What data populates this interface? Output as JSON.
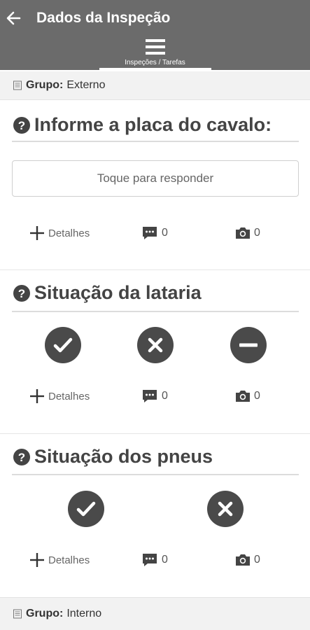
{
  "header": {
    "title": "Dados da Inspeção",
    "menu_label": "Inspeções / Tarefas"
  },
  "groups": [
    {
      "label": "Grupo:",
      "value": "Externo"
    },
    {
      "label": "Grupo:",
      "value": "Interno"
    }
  ],
  "questions": [
    {
      "text": "Informe a placa do cavalo:",
      "answer_placeholder": "Toque para responder",
      "details_label": "Detalhes",
      "comments_count": "0",
      "photos_count": "0"
    },
    {
      "text": "Situação da lataria",
      "options": [
        "check-icon",
        "x-icon",
        "minus-icon"
      ],
      "details_label": "Detalhes",
      "comments_count": "0",
      "photos_count": "0"
    },
    {
      "text": "Situação dos pneus",
      "options": [
        "check-icon",
        "x-icon"
      ],
      "details_label": "Detalhes",
      "comments_count": "0",
      "photos_count": "0"
    }
  ],
  "colors": {
    "header_bg": "#6b6b6b",
    "icon_dark": "#4a4a4a",
    "group_bg": "#f2f2f2"
  }
}
